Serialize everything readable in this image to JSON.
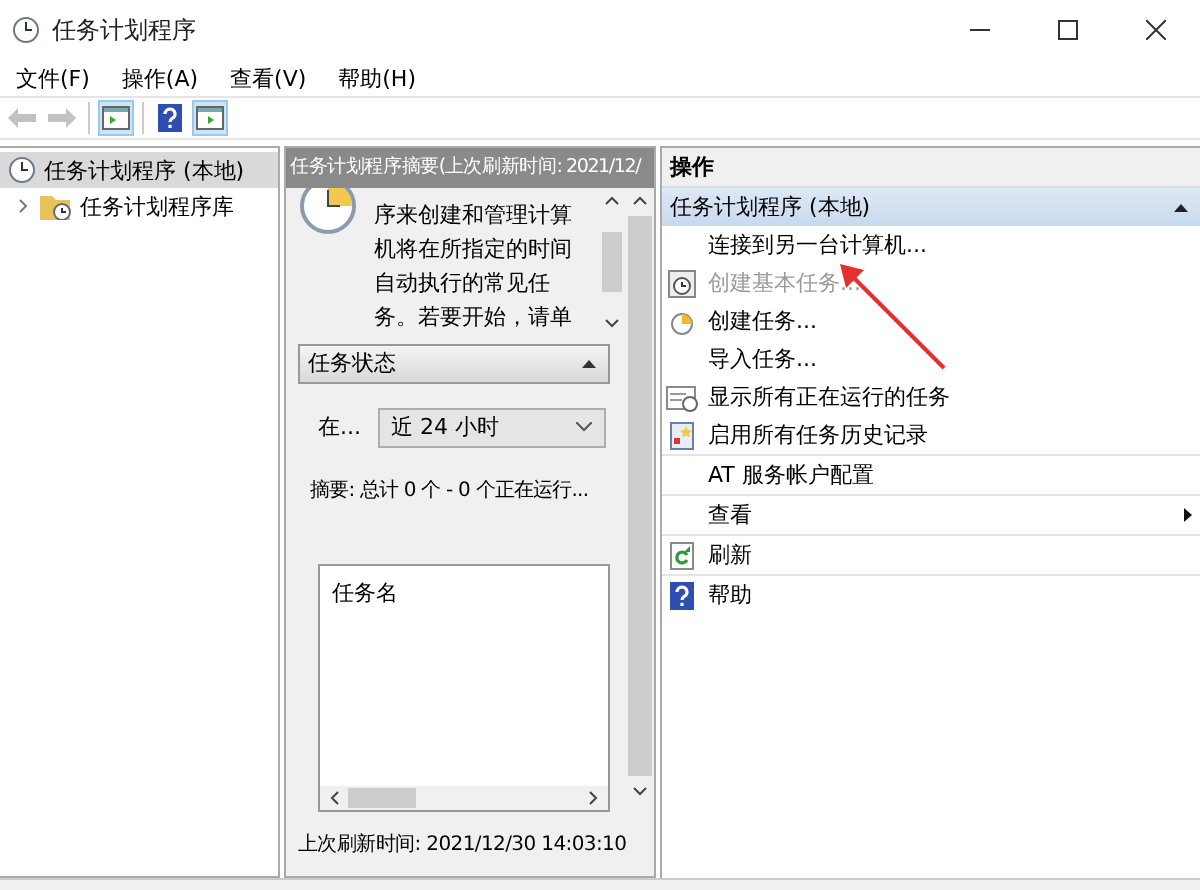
{
  "window": {
    "title": "任务计划程序"
  },
  "menu": [
    "文件(F)",
    "操作(A)",
    "查看(V)",
    "帮助(H)"
  ],
  "toolbar": [
    {
      "kind": "back",
      "disabled": true,
      "pressed": false
    },
    {
      "kind": "forward",
      "disabled": true,
      "pressed": false
    },
    {
      "kind": "tree-toggle",
      "disabled": false,
      "pressed": true
    },
    {
      "kind": "help",
      "disabled": false,
      "pressed": false
    },
    {
      "kind": "action-toggle",
      "disabled": false,
      "pressed": true
    }
  ],
  "tree": [
    {
      "label": "任务计划程序 (本地)",
      "selected": true,
      "children": [
        {
          "label": "任务计划程序库",
          "selected": false,
          "expanded": false
        }
      ]
    }
  ],
  "summary": {
    "header": "任务计划程序摘要(上次刷新时间: 2021/12/",
    "description": [
      "序来创建和管理计算",
      "机将在所指定的时间",
      "自动执行的常见任",
      "务。若要开始，请单"
    ],
    "task_status": {
      "title": "任务状态",
      "expanded": true,
      "range_label": "在...",
      "range_value": "近 24 小时",
      "summary": "摘要: 总计 0 个 - 0 个正在运行...",
      "list_column": "任务名"
    },
    "last_refresh": "上次刷新时间: 2021/12/30 14:03:10"
  },
  "actions": {
    "title": "操作",
    "groups": [
      {
        "title": "任务计划程序 (本地)",
        "expanded": true,
        "sections": [
          [
            {
              "label": "连接到另一台计算机...",
              "kind": "plain",
              "disabled": false
            },
            {
              "label": "创建基本任务...",
              "kind": "wizard",
              "disabled": true
            },
            {
              "label": "创建任务...",
              "kind": "task",
              "disabled": false
            },
            {
              "label": "导入任务...",
              "kind": "plain",
              "disabled": false
            },
            {
              "label": "显示所有正在运行的任务",
              "kind": "running",
              "disabled": false
            },
            {
              "label": "启用所有任务历史记录",
              "kind": "history",
              "disabled": false
            }
          ],
          [
            {
              "label": "AT 服务帐户配置",
              "kind": "plain",
              "disabled": false
            }
          ],
          [
            {
              "label": "查看",
              "kind": "submenu",
              "disabled": false
            }
          ],
          [
            {
              "label": "刷新",
              "kind": "refresh",
              "disabled": false
            }
          ],
          [
            {
              "label": "帮助",
              "kind": "help",
              "disabled": false
            }
          ]
        ]
      }
    ]
  }
}
